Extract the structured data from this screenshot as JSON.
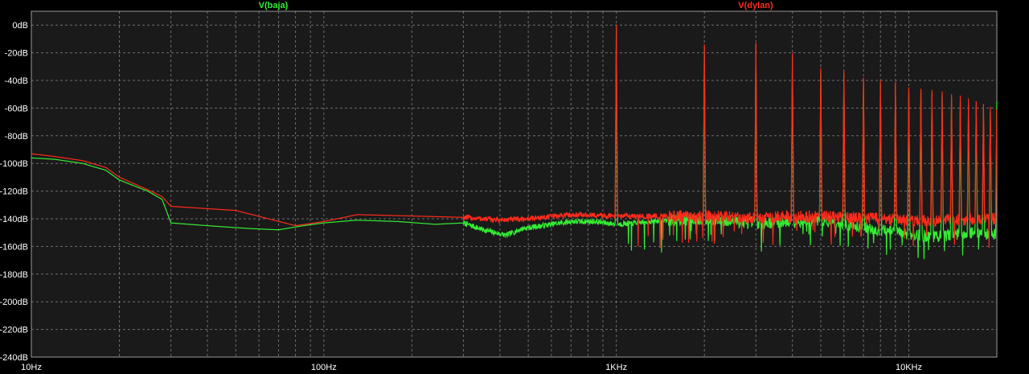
{
  "chart_data": {
    "type": "line",
    "x_scale": "log",
    "xlim": [
      10,
      20000
    ],
    "ylim": [
      -240,
      10
    ],
    "grid": true,
    "legend_position": "top",
    "background_color": "#1a1a1a",
    "grid_color": "#6e6e6e",
    "y_ticks": [
      "0dB",
      "-20dB",
      "-40dB",
      "-60dB",
      "-80dB",
      "-100dB",
      "-120dB",
      "-140dB",
      "-160dB",
      "-180dB",
      "-200dB",
      "-220dB",
      "-240dB"
    ],
    "y_tick_values": [
      0,
      -20,
      -40,
      -60,
      -80,
      -100,
      -120,
      -140,
      -160,
      -180,
      -200,
      -220,
      -240
    ],
    "x_ticks": [
      "10Hz",
      "100Hz",
      "1KHz",
      "10KHz"
    ],
    "x_tick_values": [
      10,
      100,
      1000,
      10000
    ],
    "series": [
      {
        "name": "V(baja)",
        "color": "#33ee33",
        "baseline": [
          [
            10,
            -96
          ],
          [
            12,
            -97
          ],
          [
            15,
            -100
          ],
          [
            18,
            -105
          ],
          [
            20,
            -112
          ],
          [
            25,
            -120
          ],
          [
            28,
            -126
          ],
          [
            30,
            -143
          ],
          [
            40,
            -145
          ],
          [
            55,
            -147
          ],
          [
            70,
            -148
          ],
          [
            85,
            -145
          ],
          [
            100,
            -143
          ],
          [
            130,
            -141
          ],
          [
            180,
            -142
          ],
          [
            240,
            -144
          ],
          [
            300,
            -143
          ],
          [
            350,
            -148
          ],
          [
            420,
            -152
          ],
          [
            480,
            -147
          ],
          [
            560,
            -145
          ],
          [
            700,
            -142
          ],
          [
            850,
            -142
          ],
          [
            1000,
            -144
          ],
          [
            1500,
            -141
          ],
          [
            2000,
            -140
          ],
          [
            3000,
            -143
          ],
          [
            5000,
            -141
          ],
          [
            8000,
            -148
          ],
          [
            12000,
            -153
          ],
          [
            16000,
            -150
          ],
          [
            20000,
            -151
          ]
        ],
        "harmonics": [
          [
            1000,
            -2
          ],
          [
            2000,
            -16
          ],
          [
            3000,
            -14
          ],
          [
            4000,
            -23
          ],
          [
            5000,
            -33
          ],
          [
            6000,
            -35
          ],
          [
            7000,
            -40
          ],
          [
            8000,
            -42
          ],
          [
            9000,
            -43
          ],
          [
            10000,
            -48
          ],
          [
            11000,
            -47
          ],
          [
            12000,
            -49
          ],
          [
            13000,
            -51
          ],
          [
            14000,
            -53
          ],
          [
            15000,
            -55
          ],
          [
            16000,
            -57
          ],
          [
            17000,
            -58
          ],
          [
            18000,
            -60
          ],
          [
            19000,
            -63
          ],
          [
            20000,
            -55
          ]
        ]
      },
      {
        "name": "V(dylan)",
        "color": "#ff2a1a",
        "baseline": [
          [
            10,
            -93
          ],
          [
            12,
            -95
          ],
          [
            15,
            -98
          ],
          [
            18,
            -103
          ],
          [
            20,
            -110
          ],
          [
            25,
            -119
          ],
          [
            28,
            -124
          ],
          [
            30,
            -131
          ],
          [
            50,
            -134
          ],
          [
            80,
            -145
          ],
          [
            100,
            -142
          ],
          [
            130,
            -137
          ],
          [
            200,
            -138
          ],
          [
            300,
            -139
          ],
          [
            400,
            -141
          ],
          [
            500,
            -140
          ],
          [
            700,
            -137
          ],
          [
            1000,
            -138
          ],
          [
            1500,
            -138
          ],
          [
            2000,
            -138
          ],
          [
            3000,
            -139
          ],
          [
            5000,
            -138
          ],
          [
            8000,
            -140
          ],
          [
            12000,
            -141
          ],
          [
            16000,
            -140
          ],
          [
            20000,
            -140
          ]
        ],
        "harmonics": [
          [
            1000,
            0
          ],
          [
            2000,
            -14
          ],
          [
            3000,
            -13
          ],
          [
            4000,
            -20
          ],
          [
            5000,
            -31
          ],
          [
            6000,
            -33
          ],
          [
            7000,
            -38
          ],
          [
            8000,
            -40
          ],
          [
            9000,
            -41
          ],
          [
            10000,
            -45
          ],
          [
            11000,
            -46
          ],
          [
            12000,
            -47
          ],
          [
            13000,
            -48
          ],
          [
            14000,
            -50
          ],
          [
            15000,
            -51
          ],
          [
            16000,
            -53
          ],
          [
            17000,
            -55
          ],
          [
            18000,
            -57
          ],
          [
            19000,
            -59
          ],
          [
            20000,
            -61
          ]
        ]
      }
    ]
  }
}
